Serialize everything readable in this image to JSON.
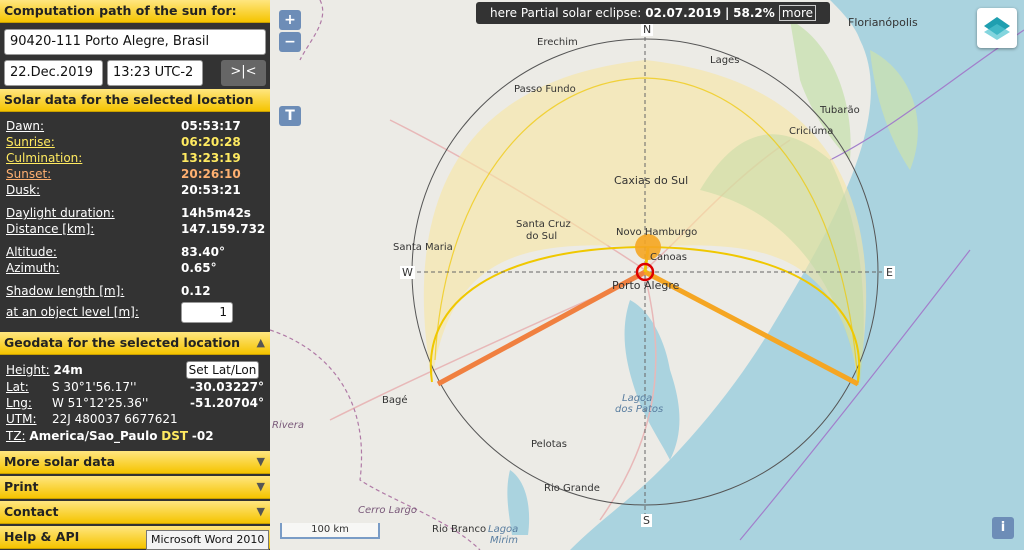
{
  "header": {
    "title": "Computation path of the sun for:"
  },
  "location": {
    "value": "90420-111 Porto Alegre, Brasil"
  },
  "date": {
    "value": "22.Dec.2019"
  },
  "time": {
    "value": "13:23 UTC-2"
  },
  "now_button": {
    "label": ">|<"
  },
  "solar": {
    "title": "Solar data for the selected location",
    "dawn": {
      "label": "Dawn:",
      "value": "05:53:17"
    },
    "sunrise": {
      "label": "Sunrise:",
      "value": "06:20:28"
    },
    "culmination": {
      "label": "Culmination:",
      "value": "13:23:19"
    },
    "sunset": {
      "label": "Sunset:",
      "value": "20:26:10"
    },
    "dusk": {
      "label": "Dusk:",
      "value": "20:53:21"
    },
    "daylight": {
      "label": "Daylight duration:",
      "value": "14h5m42s"
    },
    "distance": {
      "label": "Distance [km]:",
      "value": "147.159.732"
    },
    "altitude": {
      "label": "Altitude:",
      "value": "83.40°"
    },
    "azimuth": {
      "label": "Azimuth:",
      "value": "0.65°"
    },
    "shadow": {
      "label": "Shadow length [m]:",
      "value": "0.12"
    },
    "object": {
      "label": "at an object level [m]:",
      "value": "1"
    }
  },
  "geo": {
    "title": "Geodata for the selected location",
    "height_label": "Height:",
    "height_value": "24m",
    "set_latlon": "Set Lat/Lon",
    "lat_label": "Lat:",
    "lat_dms": "S 30°1'56.17''",
    "lat_dec": "-30.03227°",
    "lng_label": "Lng:",
    "lng_dms": "W 51°12'25.36''",
    "lng_dec": "-51.20704°",
    "utm_label": "UTM:",
    "utm_value": "22J 480037 6677621",
    "tz_label": "TZ:",
    "tz_value": "America/Sao_Paulo",
    "dst": "DST",
    "offset": "-02"
  },
  "sections": {
    "more": "More solar data",
    "print": "Print",
    "contact": "Contact",
    "help": "Help & API"
  },
  "tooltip": "Microsoft Word 2010",
  "eclipse": {
    "text": "here Partial solar eclipse:",
    "date": "02.07.2019",
    "pct": "58.2%",
    "more": "more"
  },
  "map": {
    "zoom_in": "+",
    "zoom_out": "−",
    "t_button": "T",
    "info": "i",
    "scale": "100 km",
    "compass": {
      "n": "N",
      "s": "S",
      "e": "E",
      "w": "W"
    },
    "places": {
      "florianopolis": "Florianópolis",
      "erechim": "Erechim",
      "lages": "Lages",
      "passo_fundo": "Passo Fundo",
      "tubarao": "Tubarão",
      "criciuma": "Criciúma",
      "caxias": "Caxias do Sul",
      "santa_cruz_1": "Santa Cruz",
      "santa_cruz_2": "do Sul",
      "novo_hamburgo": "Novo Hamburgo",
      "canoas": "Canoas",
      "santa_maria": "Santa Maria",
      "porto_alegre": "Porto Alegre",
      "bage": "Bagé",
      "lagoa_1": "Lagoa",
      "lagoa_2": "dos Patos",
      "pelotas": "Pelotas",
      "rio_grande": "Rio Grande",
      "cerro_largo": "Cerro Largo",
      "rio_branco": "Rio Branco",
      "lagoa_mirim_1": "Lagoa",
      "lagoa_mirim_2": "Mirim",
      "rivera": "Rivera"
    }
  },
  "colors": {
    "panel_bg": "#333333",
    "header_yellow": "#f5c400",
    "sun": "#f5a623",
    "sunrise_line": "#f08040",
    "sunset_line": "#f5a623",
    "sea": "#aad3df",
    "land": "#ecebe6"
  }
}
